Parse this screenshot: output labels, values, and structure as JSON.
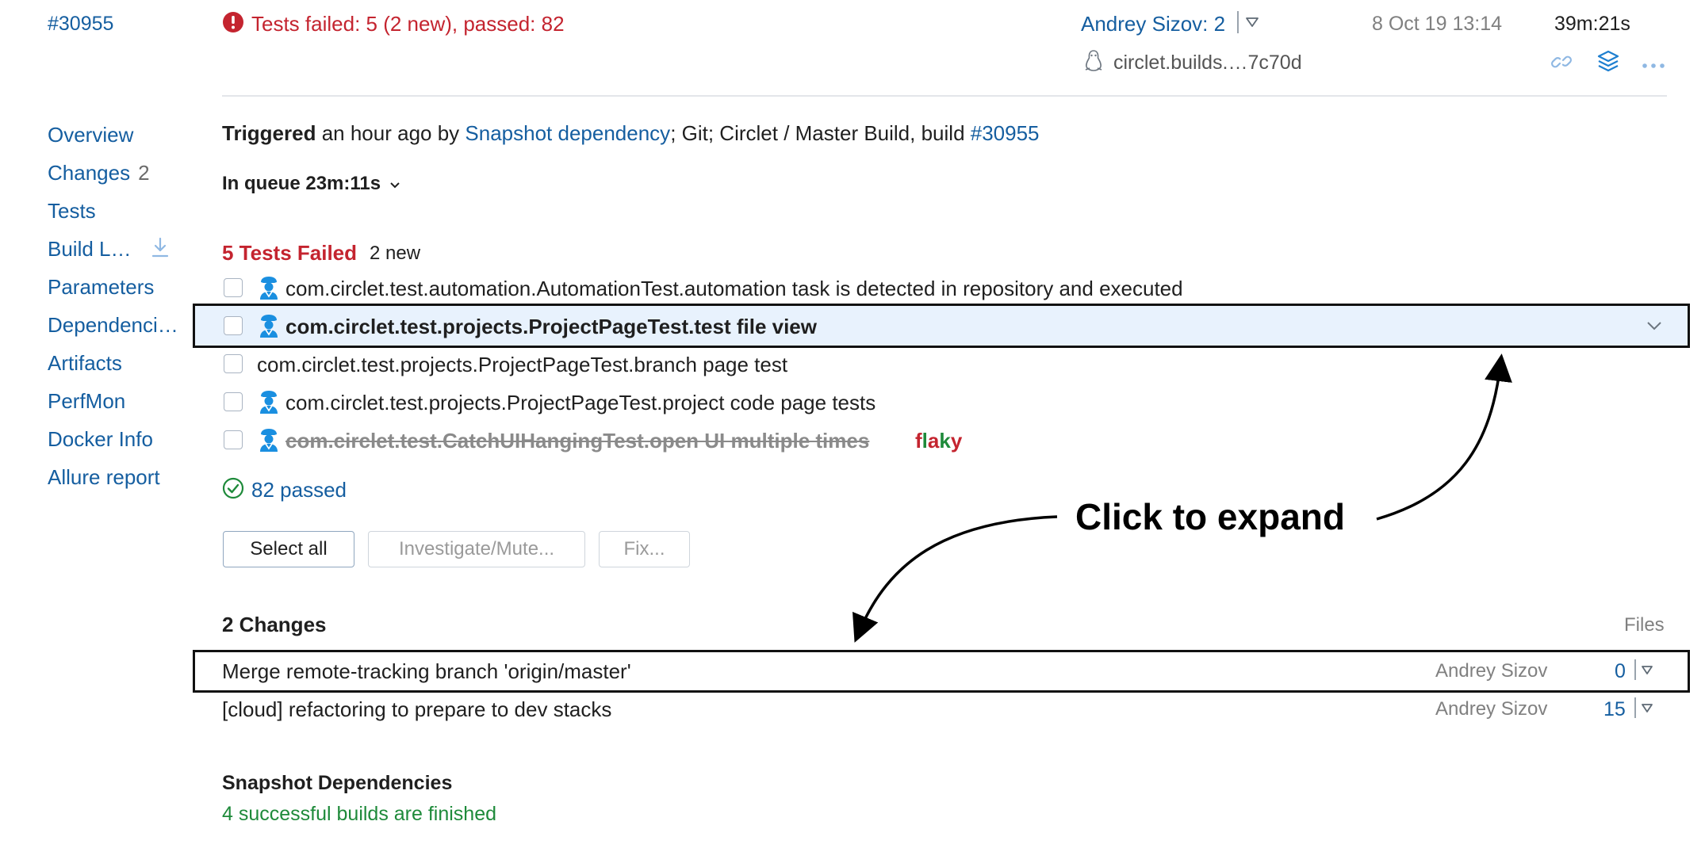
{
  "header": {
    "build_number": "#30955",
    "status_text": "Tests failed: 5 (2 new), passed: 82",
    "user_changes": "Andrey Sizov: 2",
    "date": "8 Oct 19 13:14",
    "duration": "39m:21s",
    "agent": "circlet.builds.…7c70d"
  },
  "sidebar": {
    "items": [
      {
        "label": "Overview"
      },
      {
        "label": "Changes",
        "count": "2"
      },
      {
        "label": "Tests"
      },
      {
        "label": "Build L…"
      },
      {
        "label": "Parameters"
      },
      {
        "label": "Dependenci…"
      },
      {
        "label": "Artifacts"
      },
      {
        "label": "PerfMon"
      },
      {
        "label": "Docker Info"
      },
      {
        "label": "Allure report"
      }
    ]
  },
  "trigger": {
    "prefix": "Triggered",
    "text1": " an hour ago by ",
    "link1": "Snapshot dependency",
    "text2": "; Git; Circlet / Master Build, build ",
    "link2": "#30955"
  },
  "queue": {
    "label": "In queue 23m:11s"
  },
  "tests": {
    "failed_title": "5 Tests Failed",
    "new_count": "2 new",
    "items": [
      {
        "name": "com.circlet.test.automation.AutomationTest.automation task is detected in repository and executed"
      },
      {
        "name": "com.circlet.test.projects.ProjectPageTest.test file view"
      },
      {
        "name": "com.circlet.test.projects.ProjectPageTest.branch page test"
      },
      {
        "name": "com.circlet.test.projects.ProjectPageTest.project code page tests"
      },
      {
        "name": "com.circlet.test.CatchUIHangingTest.open UI multiple times",
        "badge": "flaky"
      }
    ],
    "passed": "82 passed"
  },
  "actions": {
    "select_all": "Select all",
    "investigate": "Investigate/Mute...",
    "fix": "Fix..."
  },
  "annotation": {
    "text": "Click to expand"
  },
  "changes": {
    "title": "2 Changes",
    "files_header": "Files",
    "items": [
      {
        "message": "Merge remote-tracking branch 'origin/master'",
        "author": "Andrey Sizov",
        "files": "0"
      },
      {
        "message": "[cloud] refactoring to prepare to dev stacks",
        "author": "Andrey Sizov",
        "files": "15"
      }
    ]
  },
  "snapshot": {
    "title": "Snapshot Dependencies",
    "status": "4 successful builds are finished"
  },
  "colors": {
    "link": "#155ea0",
    "error": "#c4242f",
    "success": "#1e8a3a",
    "highlight_row": "#e8f2fd",
    "investigator_icon": "#1a8fe0"
  }
}
